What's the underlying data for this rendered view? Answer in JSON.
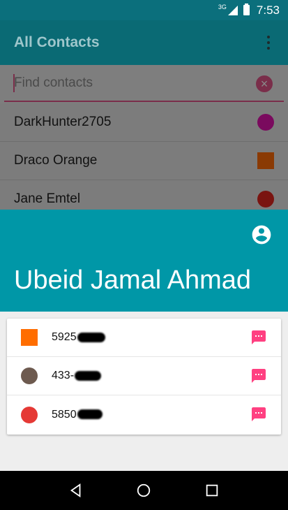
{
  "status_bar": {
    "network": "3G",
    "time": "7:53"
  },
  "app_bar": {
    "title": "All Contacts",
    "overflow_icon": "more-vert-icon"
  },
  "search": {
    "placeholder": "Find contacts",
    "value": ""
  },
  "contacts": [
    {
      "name": "DarkHunter2705",
      "marker_shape": "circle",
      "marker_color": "#7a0a5e"
    },
    {
      "name": "Draco Orange",
      "marker_shape": "square",
      "marker_color": "#8a3a04"
    },
    {
      "name": "Jane Emtel",
      "marker_shape": "circle",
      "marker_color": "#7a1410"
    }
  ],
  "detail": {
    "name": "Ubeid Jamal Ahmad",
    "header_color": "#0097a7",
    "numbers": [
      {
        "visible": "5925",
        "marker_shape": "square",
        "marker_color": "#ff6d00"
      },
      {
        "visible": "433-",
        "marker_shape": "circle",
        "marker_color": "#6d5a4f"
      },
      {
        "visible": "5850",
        "marker_shape": "circle",
        "marker_color": "#e53935"
      }
    ],
    "message_icon_color": "#ff4081"
  },
  "nav": {
    "back": "back-icon",
    "home": "home-icon",
    "recents": "recents-icon"
  }
}
